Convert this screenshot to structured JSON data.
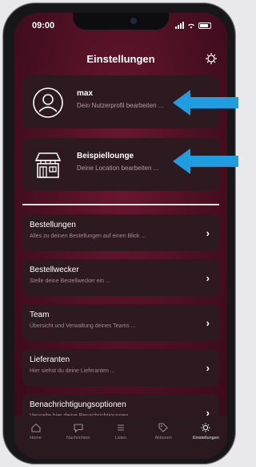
{
  "status_bar": {
    "time": "09:00"
  },
  "header": {
    "title": "Einstellungen",
    "settings_icon": "bug-gear-icon"
  },
  "profile": {
    "name": "max",
    "subtitle": "Dein Nutzerprofil bearbeiten ..."
  },
  "location": {
    "name": "Beispiellounge",
    "subtitle": "Deine Location bearbeiten ..."
  },
  "menu": [
    {
      "title": "Bestellungen",
      "subtitle": "Alles zu deinen Bestellungen auf einen Blick ..."
    },
    {
      "title": "Bestellwecker",
      "subtitle": "Stelle deine Bestellwecker ein ..."
    },
    {
      "title": "Team",
      "subtitle": "Übersicht und Verwaltung deines Teams ..."
    },
    {
      "title": "Lieferanten",
      "subtitle": "Hier siehst du deine Lieferanten ..."
    },
    {
      "title": "Benachrichtigungsoptionen",
      "subtitle": "Verwalte hier deine Benachrichtigungen ..."
    }
  ],
  "tabs": [
    {
      "label": "Home",
      "icon": "home-icon"
    },
    {
      "label": "Nachrichten",
      "icon": "chat-icon"
    },
    {
      "label": "Listen",
      "icon": "list-icon"
    },
    {
      "label": "Aktionen",
      "icon": "tag-icon"
    },
    {
      "label": "Einstellungen",
      "icon": "gear-icon",
      "active": true
    }
  ],
  "colors": {
    "background": "#4a0f22",
    "card": "#2c1a20",
    "annotation_arrow": "#1e9ee0"
  }
}
